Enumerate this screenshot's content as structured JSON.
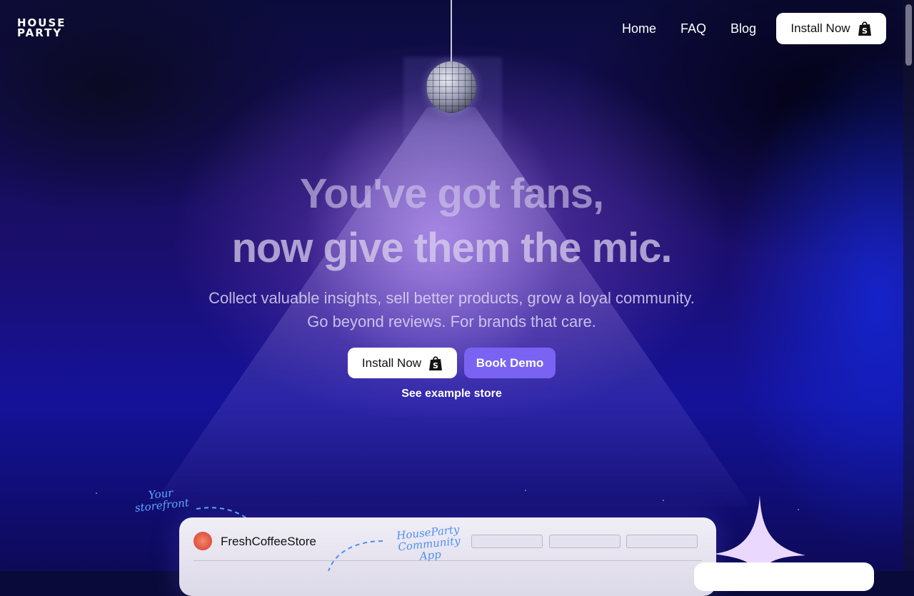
{
  "brand": {
    "logo_line1": "HOUSE",
    "logo_line2": "PARTY"
  },
  "nav": {
    "items": [
      "Home",
      "FAQ",
      "Blog"
    ],
    "install_label": "Install Now"
  },
  "hero": {
    "title_line1": "You've got fans,",
    "title_line2": "now give them the mic.",
    "subtitle_line1": "Collect valuable insights, sell better products, grow a loyal community.",
    "subtitle_line2": "Go beyond reviews. For brands that care.",
    "install_label": "Install Now",
    "demo_label": "Book Demo",
    "example_link": "See example store"
  },
  "preview": {
    "storefront_note_line1": "Your",
    "storefront_note_line2": "storefront",
    "community_note_line1": "HouseParty",
    "community_note_line2": "Community App",
    "store_name": "FreshCoffeeStore"
  },
  "colors": {
    "accent": "#7a63f2",
    "background": "#1b0e6e",
    "annotation": "#5fa6ff"
  },
  "icons": {
    "shop": "shopify-bag-icon",
    "ball": "disco-ball-icon",
    "sparkle": "sparkle-icon"
  }
}
